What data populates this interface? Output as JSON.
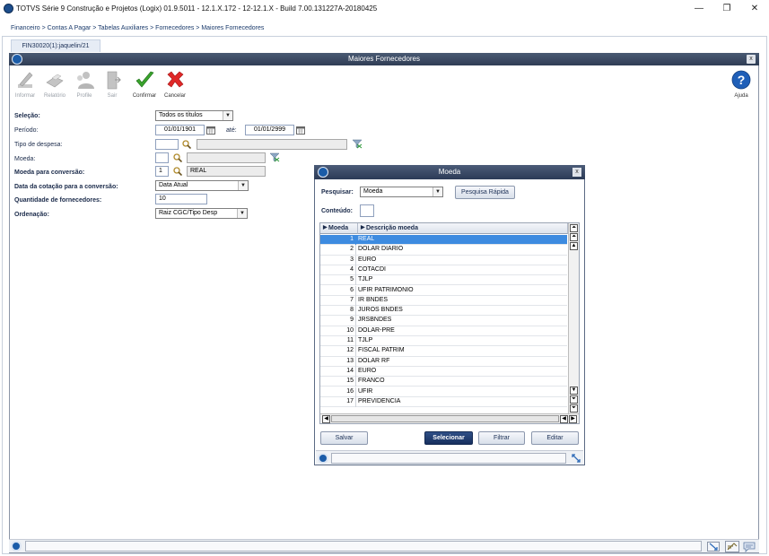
{
  "window": {
    "title": "TOTVS Série 9 Construção e Projetos (Logix) 01.9.5011 - 12.1.X.172 - 12-12.1.X - Build 7.00.131227A-20180425",
    "minimize": "—",
    "restore": "❐",
    "close": "✕"
  },
  "breadcrumb": "Financeiro > Contas A Pagar > Tabelas Auxiliares > Fornecedores > Maiores Fornecedores",
  "tab": {
    "label": "FIN30020(1):jaquelin/21"
  },
  "form_window": {
    "title": "Maiores Fornecedores",
    "close": "x"
  },
  "toolbar": {
    "items": [
      {
        "label": "Informar",
        "icon": "pencil-icon",
        "enabled": false
      },
      {
        "label": "Relatório",
        "icon": "printer-icon",
        "enabled": false
      },
      {
        "label": "Profile",
        "icon": "profile-icon",
        "enabled": false
      },
      {
        "label": "Sair",
        "icon": "exit-icon",
        "enabled": false
      },
      {
        "label": "Confirmar",
        "icon": "check-icon",
        "enabled": true
      },
      {
        "label": "Cancelar",
        "icon": "cancel-icon",
        "enabled": true
      }
    ],
    "help": {
      "label": "Ajuda",
      "icon": "help-icon"
    }
  },
  "form": {
    "selecao": {
      "label": "Seleção:",
      "value": "Todos os títulos"
    },
    "periodo": {
      "label": "Período:",
      "from": "01/01/1901",
      "ate": "até:",
      "to": "01/01/2999"
    },
    "tipo_despesa": {
      "label": "Tipo de despesa:",
      "value": "",
      "desc": ""
    },
    "moeda": {
      "label": "Moeda:",
      "value": "",
      "desc": ""
    },
    "moeda_conversao": {
      "label": "Moeda para conversão:",
      "value": "1",
      "desc": "REAL"
    },
    "data_cotacao": {
      "label": "Data da cotação para a conversão:",
      "value": "Data Atual"
    },
    "qtd_fornecedores": {
      "label": "Quantidade de fornecedores:",
      "value": "10"
    },
    "ordenacao": {
      "label": "Ordenação:",
      "value": "Raiz CGC/Tipo Desp"
    }
  },
  "dialog": {
    "title": "Moeda",
    "close": "x",
    "pesquisar_label": "Pesquisar:",
    "pesquisar_value": "Moeda",
    "pesquisa_rapida": "Pesquisa Rápida",
    "conteudo_label": "Conteúdo:",
    "conteudo_value": "",
    "columns": [
      "Moeda",
      "Descrição moeda"
    ],
    "rows": [
      {
        "code": "1",
        "desc": "REAL"
      },
      {
        "code": "2",
        "desc": "DOLAR DIARIO"
      },
      {
        "code": "3",
        "desc": "EURO"
      },
      {
        "code": "4",
        "desc": "COTACDI"
      },
      {
        "code": "5",
        "desc": "TJLP"
      },
      {
        "code": "6",
        "desc": "UFIR PATRIMONIO"
      },
      {
        "code": "7",
        "desc": "IR BNDES"
      },
      {
        "code": "8",
        "desc": "JUROS BNDES"
      },
      {
        "code": "9",
        "desc": "JRSBNDES"
      },
      {
        "code": "10",
        "desc": "DOLAR-PRE"
      },
      {
        "code": "11",
        "desc": "TJLP"
      },
      {
        "code": "12",
        "desc": "FISCAL PATRIM"
      },
      {
        "code": "13",
        "desc": "DOLAR RF"
      },
      {
        "code": "14",
        "desc": "EURO"
      },
      {
        "code": "15",
        "desc": "FRANCO"
      },
      {
        "code": "16",
        "desc": "UFIR"
      },
      {
        "code": "17",
        "desc": "PREVIDENCIA"
      }
    ],
    "selected_row": 0,
    "buttons": {
      "salvar": "Salvar",
      "selecionar": "Selecionar",
      "filtrar": "Filtrar",
      "editar": "Editar"
    }
  },
  "colors": {
    "title_bar": "#2f3d55",
    "selection": "#3d8be0",
    "primary_button": "#172f5e"
  }
}
